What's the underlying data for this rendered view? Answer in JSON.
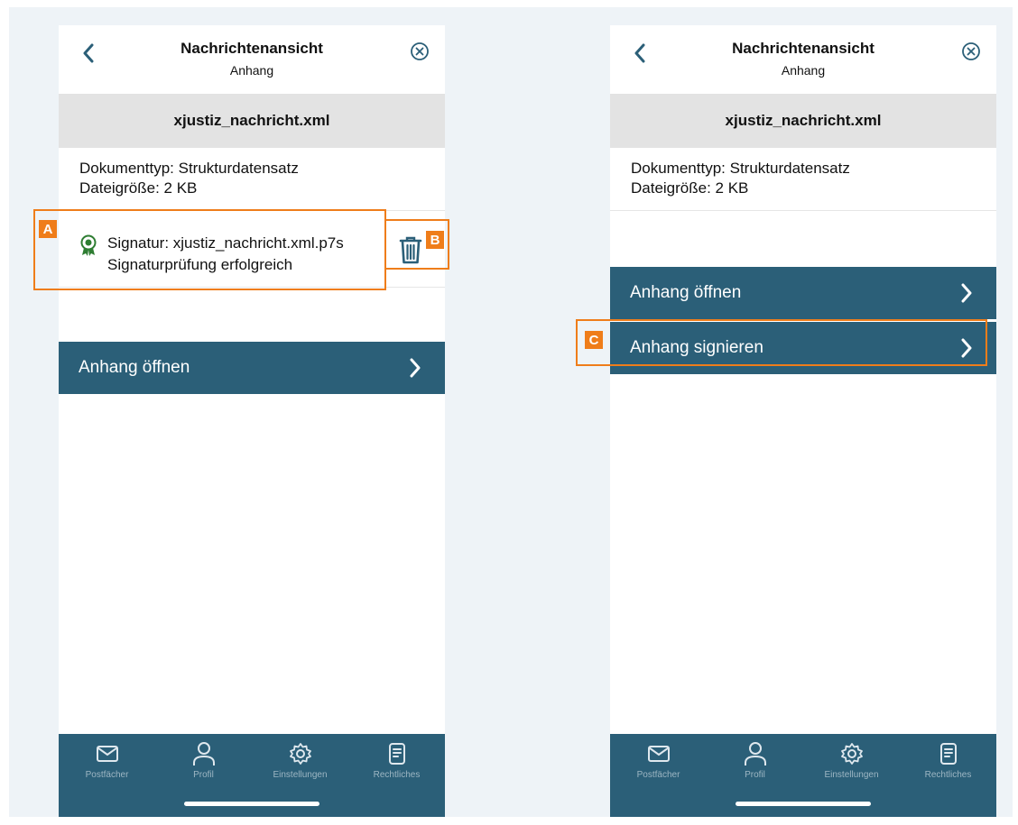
{
  "colors": {
    "accent": "#2b5f78",
    "annotation": "#ef7d1a",
    "signature_ok": "#2e7d32",
    "background": "#eef3f7"
  },
  "left_screen": {
    "header": {
      "title": "Nachrichtenansicht",
      "subtitle": "Anhang",
      "back_icon": "chevron-left-icon",
      "close_icon": "close-circle-icon"
    },
    "file_name": "xjustiz_nachricht.xml",
    "document_type": "Dokumenttyp: Strukturdatensatz",
    "file_size": "Dateigröße: 2 KB",
    "signature": {
      "icon": "award-badge-icon",
      "name": "Signatur: xjustiz_nachricht.xml.p7s",
      "status": "Signaturprüfung erfolgreich",
      "delete_icon": "trash-icon"
    },
    "actions": [
      {
        "label": "Anhang öffnen"
      }
    ]
  },
  "right_screen": {
    "header": {
      "title": "Nachrichtenansicht",
      "subtitle": "Anhang",
      "back_icon": "chevron-left-icon",
      "close_icon": "close-circle-icon"
    },
    "file_name": "xjustiz_nachricht.xml",
    "document_type": "Dokumenttyp: Strukturdatensatz",
    "file_size": "Dateigröße: 2 KB",
    "actions": [
      {
        "label": "Anhang öffnen"
      },
      {
        "label": "Anhang signieren"
      }
    ]
  },
  "tabbar": {
    "items": [
      {
        "label": "Postfächer",
        "icon": "mail-icon"
      },
      {
        "label": "Profil",
        "icon": "user-icon"
      },
      {
        "label": "Einstellungen",
        "icon": "gear-icon"
      },
      {
        "label": "Rechtliches",
        "icon": "document-icon"
      }
    ]
  },
  "annotations": [
    {
      "label": "A"
    },
    {
      "label": "B"
    },
    {
      "label": "C"
    }
  ]
}
